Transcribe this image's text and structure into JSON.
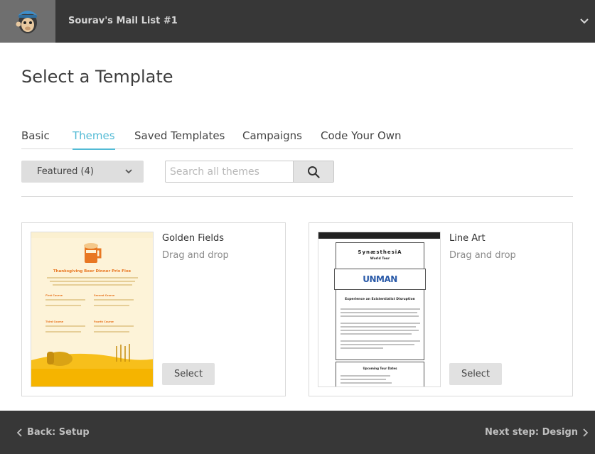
{
  "header": {
    "list_name": "Sourav's Mail List #1",
    "logo_icon": "chimp-logo-icon",
    "menu_icon": "chevron-down-icon"
  },
  "page": {
    "title": "Select a Template"
  },
  "tabs": [
    {
      "label": "Basic",
      "active": false
    },
    {
      "label": "Themes",
      "active": true
    },
    {
      "label": "Saved Templates",
      "active": false
    },
    {
      "label": "Campaigns",
      "active": false
    },
    {
      "label": "Code Your Own",
      "active": false
    }
  ],
  "filter": {
    "selected": "Featured (4)",
    "search_placeholder": "Search all themes"
  },
  "templates": [
    {
      "name": "Golden Fields",
      "type": "Drag and drop",
      "select_label": "Select",
      "thumb_heading": "Thanksgiving Beer Dinner Prix Fixe",
      "thumb_courses": [
        "First Course",
        "Second Course",
        "Third Course",
        "Fourth Course"
      ]
    },
    {
      "name": "Line Art",
      "type": "Drag and drop",
      "select_label": "Select",
      "thumb_title": "SynæsthesiA",
      "thumb_subtitle": "World Tour",
      "thumb_logo": "UNMAN",
      "thumb_heading": "Experience an Existentialist Disruption",
      "thumb_section": "Upcoming Tour Dates"
    }
  ],
  "footer": {
    "back_label": "Back: Setup",
    "next_label": "Next step: Design"
  },
  "colors": {
    "accent": "#52bad5",
    "header_bg": "#373737",
    "field_yellow": "#f7bf1b",
    "thumb_orange": "#e87722"
  }
}
